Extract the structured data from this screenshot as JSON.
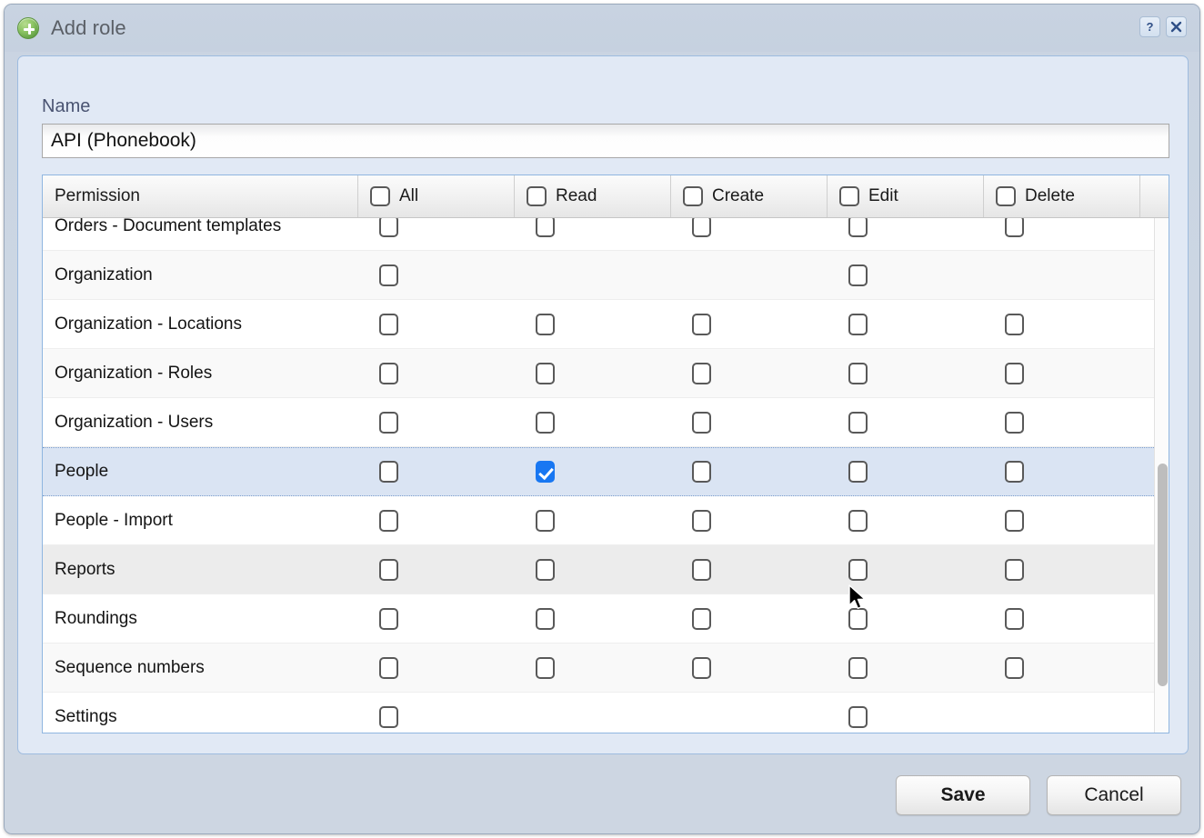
{
  "window": {
    "title": "Add role",
    "icon": "green-plus-icon",
    "help_button": "?",
    "close_button": "✕"
  },
  "form": {
    "name_label": "Name",
    "name_value": "API (Phonebook)",
    "name_placeholder": ""
  },
  "grid": {
    "columns": [
      {
        "key": "permission",
        "label": "Permission",
        "has_checkbox": false
      },
      {
        "key": "all",
        "label": "All",
        "has_checkbox": true,
        "checked": false
      },
      {
        "key": "read",
        "label": "Read",
        "has_checkbox": true,
        "checked": false
      },
      {
        "key": "create",
        "label": "Create",
        "has_checkbox": true,
        "checked": false
      },
      {
        "key": "edit",
        "label": "Edit",
        "has_checkbox": true,
        "checked": false
      },
      {
        "key": "delete",
        "label": "Delete",
        "has_checkbox": true,
        "checked": false
      }
    ],
    "rows": [
      {
        "label": "Orders - Document templates",
        "clipped": true,
        "state": "normal",
        "cells": {
          "all": "unchecked",
          "read": "unchecked",
          "create": "unchecked",
          "edit": "unchecked",
          "delete": "unchecked"
        }
      },
      {
        "label": "Organization",
        "clipped": false,
        "state": "alt",
        "cells": {
          "all": "unchecked",
          "read": "none",
          "create": "none",
          "edit": "unchecked",
          "delete": "none"
        }
      },
      {
        "label": "Organization - Locations",
        "clipped": false,
        "state": "normal",
        "cells": {
          "all": "unchecked",
          "read": "unchecked",
          "create": "unchecked",
          "edit": "unchecked",
          "delete": "unchecked"
        }
      },
      {
        "label": "Organization - Roles",
        "clipped": false,
        "state": "alt",
        "cells": {
          "all": "unchecked",
          "read": "unchecked",
          "create": "unchecked",
          "edit": "unchecked",
          "delete": "unchecked"
        }
      },
      {
        "label": "Organization - Users",
        "clipped": false,
        "state": "normal",
        "cells": {
          "all": "unchecked",
          "read": "unchecked",
          "create": "unchecked",
          "edit": "unchecked",
          "delete": "unchecked"
        }
      },
      {
        "label": "People",
        "clipped": false,
        "state": "selected",
        "cells": {
          "all": "unchecked",
          "read": "checked",
          "create": "unchecked",
          "edit": "unchecked",
          "delete": "unchecked"
        }
      },
      {
        "label": "People - Import",
        "clipped": false,
        "state": "normal",
        "cells": {
          "all": "unchecked",
          "read": "unchecked",
          "create": "unchecked",
          "edit": "unchecked",
          "delete": "unchecked"
        }
      },
      {
        "label": "Reports",
        "clipped": false,
        "state": "hover",
        "cells": {
          "all": "unchecked",
          "read": "unchecked",
          "create": "unchecked",
          "edit": "unchecked",
          "delete": "unchecked"
        }
      },
      {
        "label": "Roundings",
        "clipped": false,
        "state": "normal",
        "cells": {
          "all": "unchecked",
          "read": "unchecked",
          "create": "unchecked",
          "edit": "unchecked",
          "delete": "unchecked"
        }
      },
      {
        "label": "Sequence numbers",
        "clipped": false,
        "state": "alt",
        "cells": {
          "all": "unchecked",
          "read": "unchecked",
          "create": "unchecked",
          "edit": "unchecked",
          "delete": "unchecked"
        }
      },
      {
        "label": "Settings",
        "clipped": false,
        "state": "normal",
        "cells": {
          "all": "unchecked",
          "read": "none",
          "create": "none",
          "edit": "unchecked",
          "delete": "none"
        }
      }
    ]
  },
  "footer": {
    "save_label": "Save",
    "cancel_label": "Cancel"
  },
  "colors": {
    "checkbox_checked": "#1877f2",
    "selected_row": "#dae4f3",
    "panel_background": "#e1e9f5",
    "dialog_background": "#ccd6e3",
    "panel_border": "#9dbbdf",
    "title_text": "#5a5f66",
    "label_text": "#4a5472"
  }
}
